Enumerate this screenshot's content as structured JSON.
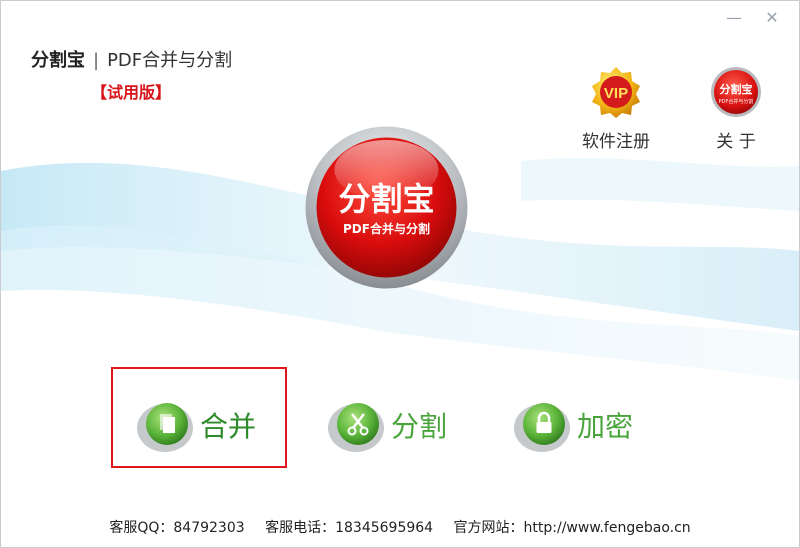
{
  "window": {
    "minimize_glyph": "—",
    "close_glyph": "✕"
  },
  "header": {
    "brand": "分割宝",
    "separator": "|",
    "subtitle": "PDF合并与分割",
    "edition": "【试用版】"
  },
  "top_actions": {
    "register": {
      "label": "软件注册",
      "badge": "VIP",
      "icon": "vip-badge-icon"
    },
    "about": {
      "label": "关 于",
      "badge": "分割宝",
      "badge_sub": "PDF合并与分割",
      "icon": "app-logo-icon"
    }
  },
  "logo": {
    "title": "分割宝",
    "subtitle": "PDF合并与分割"
  },
  "actions": [
    {
      "id": "merge",
      "label": "合并",
      "icon": "document-icon"
    },
    {
      "id": "split",
      "label": "分割",
      "icon": "scissors-icon"
    },
    {
      "id": "encrypt",
      "label": "加密",
      "icon": "lock-icon"
    }
  ],
  "footer": {
    "qq": "客服QQ：84792303",
    "phone": "客服电话：18345695964",
    "website": "官方网站：http://www.fengebao.cn"
  },
  "colors": {
    "accent_red": "#d8141a",
    "accent_green": "#4aa43c",
    "highlight_border": "#e0161c"
  }
}
